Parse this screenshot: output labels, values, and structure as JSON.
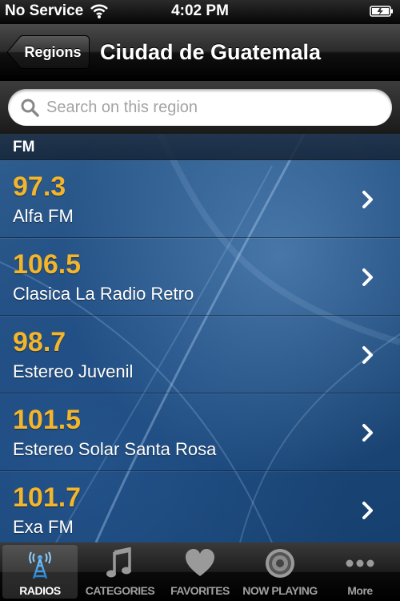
{
  "status_bar": {
    "carrier": "No Service",
    "time": "4:02 PM"
  },
  "nav": {
    "back_label": "Regions",
    "title": "Ciudad de Guatemala"
  },
  "search": {
    "placeholder": "Search on this region",
    "value": ""
  },
  "section": {
    "title": "FM"
  },
  "stations": [
    {
      "frequency": "97.3",
      "name": "Alfa FM"
    },
    {
      "frequency": "106.5",
      "name": "Clasica La Radio Retro"
    },
    {
      "frequency": "98.7",
      "name": "Estereo Juvenil"
    },
    {
      "frequency": "101.5",
      "name": "Estereo Solar Santa Rosa"
    },
    {
      "frequency": "101.7",
      "name": "Exa FM"
    }
  ],
  "tabs": [
    {
      "label": "RADIOS",
      "icon": "radio-tower-icon",
      "active": true
    },
    {
      "label": "CATEGORIES",
      "icon": "music-note-icon",
      "active": false
    },
    {
      "label": "FAVORITES",
      "icon": "heart-icon",
      "active": false
    },
    {
      "label": "NOW PLAYING",
      "icon": "speaker-icon",
      "active": false
    },
    {
      "label": "More",
      "icon": "more-dots-icon",
      "active": false
    }
  ],
  "colors": {
    "frequency": "#f2b52c",
    "background": "#1e4a7c",
    "active_tab_icon": "#3da2ea"
  }
}
